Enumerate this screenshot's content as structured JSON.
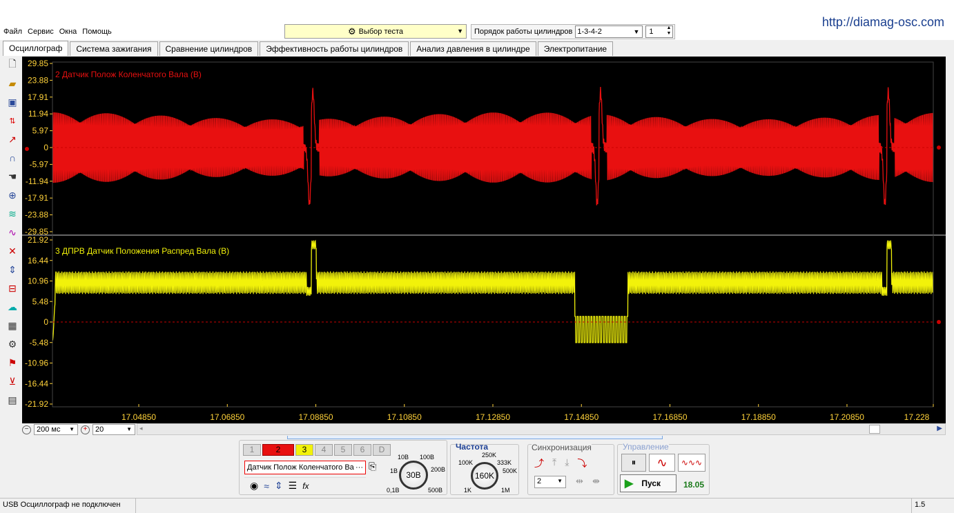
{
  "header": {
    "url": "http://diamag-osc.com",
    "menu": [
      "Файл",
      "Сервис",
      "Окна",
      "Помощь"
    ],
    "test_select": "Выбор теста",
    "order_label": "Порядок работы цилиндров",
    "order_value": "1-3-4-2",
    "cylinder_value": "1"
  },
  "tabs": [
    "Осциллограф",
    "Система зажигания",
    "Сравнение цилиндров",
    "Эффективность работы цилиндров",
    "Анализ давления в цилиндре",
    "Электропитание"
  ],
  "left_toolbar": [
    "new-file-icon",
    "open-folder-icon",
    "save-icon",
    "auto-scale-icon",
    "measure-icon",
    "curve-icon",
    "hand-pan-icon",
    "zoom-icon",
    "filter-icon",
    "multi-wave-icon",
    "cross-icon",
    "marker-icon",
    "scale-icon",
    "wave-color-icon",
    "table-icon",
    "auto-settings-icon",
    "flag-icon",
    "trigger-icon",
    "notes-icon"
  ],
  "chart_data": [
    {
      "type": "line",
      "title": "2 Датчик Полож Коленчатого Вала (В)",
      "series_color": "#e81010",
      "yticks": [
        "29.85",
        "23.88",
        "17.91",
        "11.94",
        "5.97",
        "0",
        "-5.97",
        "-11.94",
        "-17.91",
        "-23.88",
        "-29.85"
      ],
      "ylim": [
        -29.85,
        29.85
      ],
      "signal": {
        "kind": "carrier with gap pulse",
        "oscillation_amplitude": 12.5,
        "gap_spike_max": 19.8,
        "gap_spike_min": -20.0,
        "gap_times": [
          17.0875,
          17.1525,
          17.2175
        ]
      }
    },
    {
      "type": "line",
      "title": "3 ДПРВ Датчик Положения Распред Вала (В)",
      "series_color": "#f2f20a",
      "yticks": [
        "21.92",
        "16.44",
        "10.96",
        "5.48",
        "0",
        "-5.48",
        "-10.96",
        "-16.44",
        "-21.92"
      ],
      "ylim": [
        -21.92,
        21.92
      ],
      "signal": {
        "kind": "square-ish oscillation with low window",
        "high_level_range": [
          7.5,
          13.5
        ],
        "low_level_range": [
          -5.5,
          1.5
        ],
        "low_window": [
          17.147,
          17.159
        ],
        "spike_times": [
          17.0875,
          17.2175
        ]
      }
    }
  ],
  "x_axis": {
    "ticks": [
      "17.04850",
      "17.06850",
      "17.08850",
      "17.10850",
      "17.12850",
      "17.14850",
      "17.16850",
      "17.18850",
      "17.20850",
      "17.228"
    ],
    "tick_values": [
      17.0485,
      17.0685,
      17.0885,
      17.1085,
      17.1285,
      17.1485,
      17.1685,
      17.1885,
      17.2085,
      17.228
    ],
    "xlim": [
      17.029,
      17.228
    ]
  },
  "controls": {
    "timebase": "200 мс",
    "divisions": "20",
    "channels": [
      "1",
      "2",
      "3",
      "4",
      "5",
      "6",
      "D"
    ],
    "active_channel": "2",
    "channel_name": "Датчик Полож Коленчатого Ва",
    "voltage_scale_labels": [
      "10В",
      "100В",
      "1В",
      "200В",
      "0,1В",
      "500В"
    ],
    "voltage_value": "30В",
    "freq_title": "Частота",
    "freq_labels": [
      "250K",
      "100K",
      "333K",
      "500K",
      "1K",
      "1M"
    ],
    "freq_value": "160K",
    "sync_title": "Синхронизация",
    "sync_channel": "2",
    "mgmt_title": "Управление",
    "start_label": "Пуск",
    "time_value": "18.05"
  },
  "status": {
    "text": "USB Осциллограф не подключен",
    "version": "1.5"
  }
}
